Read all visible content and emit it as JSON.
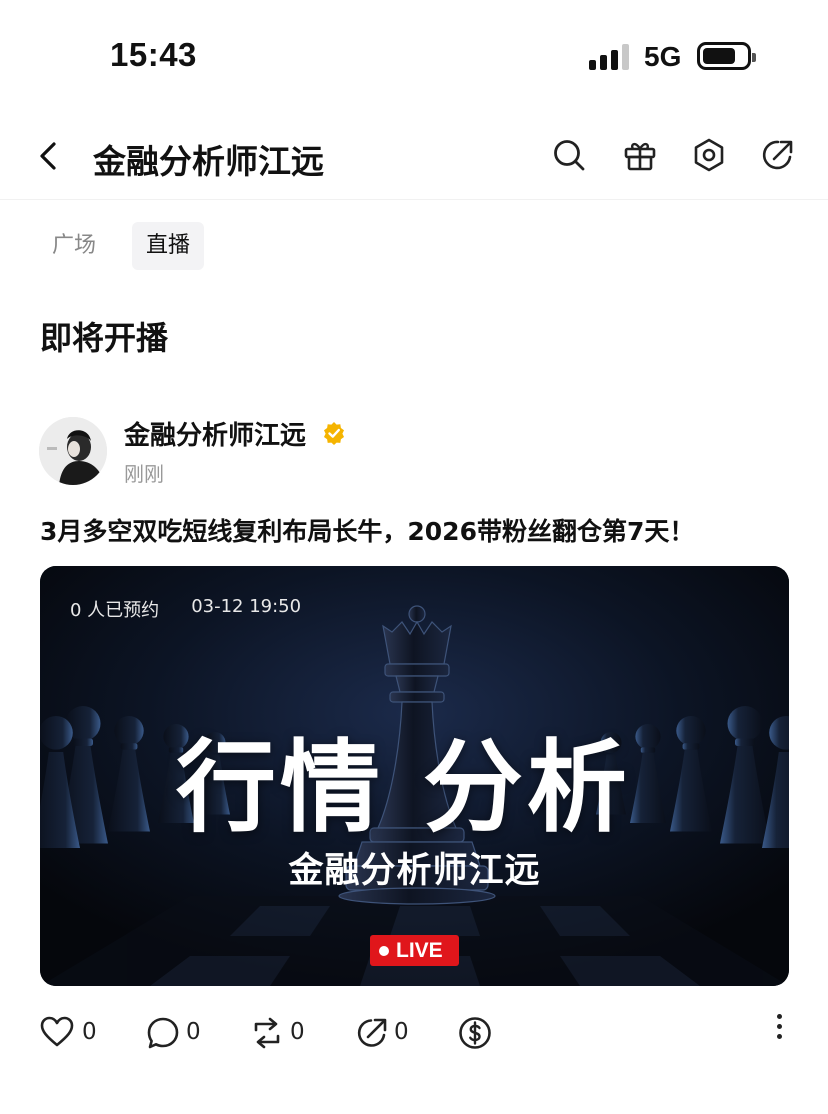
{
  "status_bar": {
    "time": "15:43",
    "network": "5G",
    "battery_level": 0.75
  },
  "header": {
    "back_icon": "chevron-left-icon",
    "title": "金融分析师江远",
    "icons": [
      "search-icon",
      "gift-icon",
      "settings-icon",
      "share-icon"
    ]
  },
  "tabs": [
    {
      "label": "广场",
      "active": false
    },
    {
      "label": "直播",
      "active": true
    }
  ],
  "section": {
    "title": "即将开播"
  },
  "post": {
    "author": "金融分析师江远",
    "verified_color": "#f5b400",
    "time": "刚刚",
    "text": "3月多空双吃短线复利布局长牛，2026带粉丝翻仓第7天！",
    "banner": {
      "reservations": "0 人已预约",
      "datetime": "03-12 19:50",
      "headline": "行情 分析",
      "subtitle": "金融分析师江远",
      "live_label": "LIVE",
      "live_color": "#e0161b"
    },
    "actions": {
      "like_count": "0",
      "comment_count": "0",
      "repost_count": "0",
      "share_count": "0",
      "tip_icon": "dollar-circle-icon",
      "more_icon": "more-vertical-icon"
    }
  }
}
